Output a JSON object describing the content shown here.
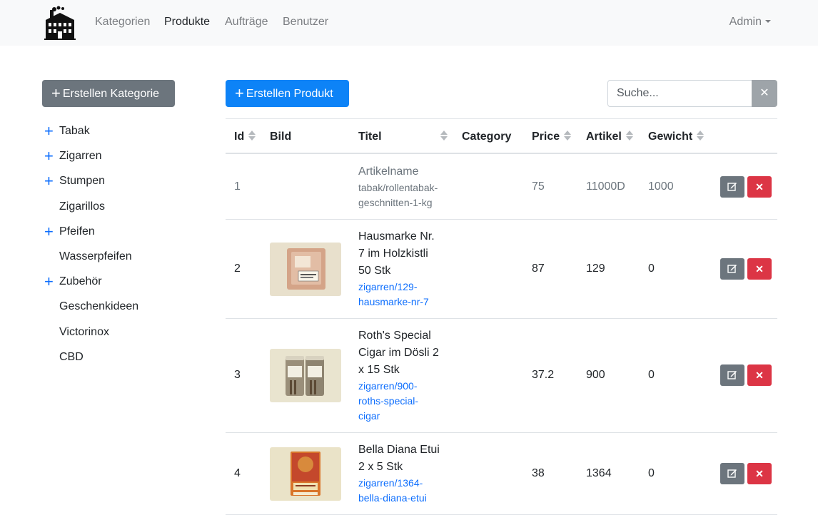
{
  "nav": {
    "links": [
      "Kategorien",
      "Produkte",
      "Aufträge",
      "Benutzer"
    ],
    "active": "Produkte",
    "user_menu": "Admin",
    "logo_icon": "factory-logo"
  },
  "sidebar": {
    "create_label": "Erstellen Kategorie",
    "categories": [
      {
        "label": "Tabak",
        "expandable": true
      },
      {
        "label": "Zigarren",
        "expandable": true
      },
      {
        "label": "Stumpen",
        "expandable": true
      },
      {
        "label": "Zigarillos",
        "expandable": false
      },
      {
        "label": "Pfeifen",
        "expandable": true
      },
      {
        "label": "Wasserpfeifen",
        "expandable": false
      },
      {
        "label": "Zubehör",
        "expandable": true
      },
      {
        "label": "Geschenkideen",
        "expandable": false
      },
      {
        "label": "Victorinox",
        "expandable": false
      },
      {
        "label": "CBD",
        "expandable": false
      }
    ]
  },
  "toolbar": {
    "create_label": "Erstellen Produkt",
    "search_placeholder": "Suche...",
    "clear_symbol": "✕"
  },
  "table": {
    "headers": {
      "id": "Id",
      "image": "Bild",
      "title": "Titel",
      "category": "Category",
      "price": "Price",
      "article": "Artikel",
      "weight": "Gewicht"
    },
    "rows": [
      {
        "id": "1",
        "title_lines": [
          "Artikelname"
        ],
        "slug_lines": [
          "tabak/rollentabak-",
          "geschnitten-1-kg"
        ],
        "category": "",
        "price": "75",
        "article": "11000D",
        "weight": "1000",
        "muted": true,
        "image": ""
      },
      {
        "id": "2",
        "title_lines": [
          "Hausmarke Nr.",
          "7 im Holzkistli",
          "50 Stk"
        ],
        "slug_lines": [
          "zigarren/129-",
          "hausmarke-nr-7"
        ],
        "category": "",
        "price": "87",
        "article": "129",
        "weight": "0",
        "muted": false,
        "image": "wooden cigar box"
      },
      {
        "id": "3",
        "title_lines": [
          "Roth's Special",
          "Cigar im Dösli 2",
          "x 15 Stk"
        ],
        "slug_lines": [
          "zigarren/900-",
          "roths-special-",
          "cigar"
        ],
        "category": "",
        "price": "37.2",
        "article": "900",
        "weight": "0",
        "muted": false,
        "image": "cigar tins"
      },
      {
        "id": "4",
        "title_lines": [
          "Bella Diana Etui",
          "2 x 5 Stk"
        ],
        "slug_lines": [
          "zigarren/1364-",
          "bella-diana-etui"
        ],
        "category": "",
        "price": "38",
        "article": "1364",
        "weight": "0",
        "muted": false,
        "image": "cigar pack"
      }
    ],
    "edit_icon": "edit-icon",
    "delete_symbol": "✕"
  },
  "colors": {
    "primary": "#0d83f7",
    "secondary": "#6c757d",
    "danger": "#dc3545",
    "link": "#0d6efd"
  }
}
